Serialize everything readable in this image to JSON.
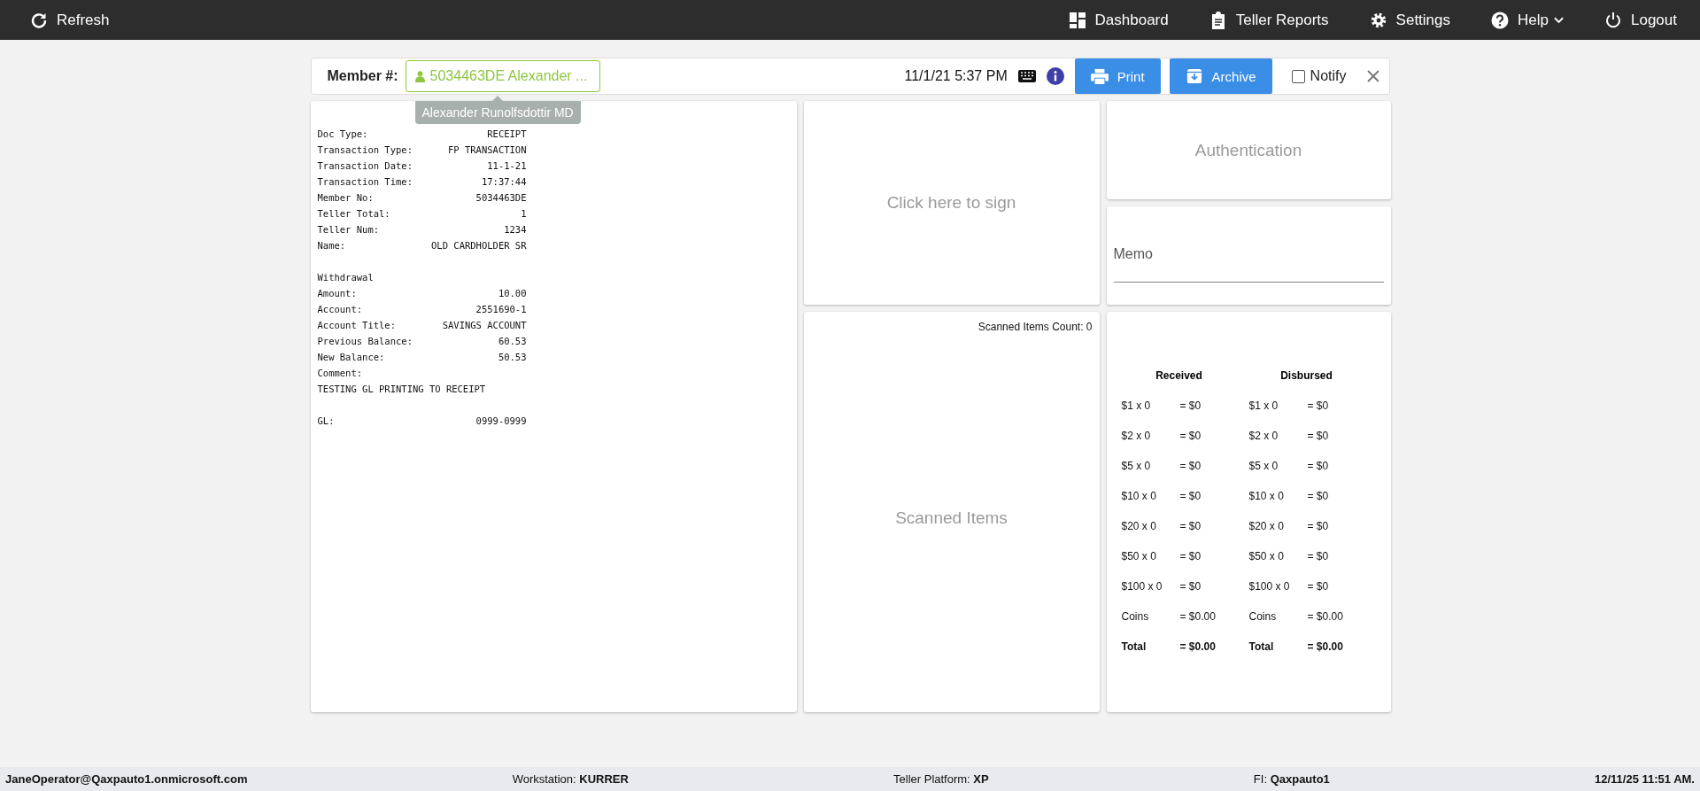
{
  "top_bar": {
    "left": [
      {
        "label": "Refresh"
      }
    ],
    "right": [
      {
        "label": "Dashboard",
        "dropdown": false
      },
      {
        "label": "Teller Reports",
        "dropdown": false
      },
      {
        "label": "Settings",
        "dropdown": false
      },
      {
        "label": "Help",
        "dropdown": true
      },
      {
        "label": "Logout",
        "dropdown": false
      }
    ]
  },
  "header": {
    "member_label": "Member #:",
    "member_value": "5034463DE Alexander ...",
    "tooltip": "Alexander Runolfsdottir MD",
    "datetime": "11/1/21 5:37 PM",
    "print_button": "Print",
    "archive_button": "Archive",
    "notify": {
      "label": "Notify",
      "checked": false
    }
  },
  "receipt": [
    {
      "kind": "pair",
      "label": "Doc Type:",
      "value": "RECEIPT"
    },
    {
      "kind": "pair",
      "label": "Transaction Type:",
      "value": "FP TRANSACTION"
    },
    {
      "kind": "pair",
      "label": "Transaction Date:",
      "value": "11-1-21"
    },
    {
      "kind": "pair",
      "label": "Transaction Time:",
      "value": "17:37:44"
    },
    {
      "kind": "pair",
      "label": "Member No:",
      "value": "5034463DE"
    },
    {
      "kind": "pair",
      "label": "Teller Total:",
      "value": "1"
    },
    {
      "kind": "pair",
      "label": "Teller Num:",
      "value": "1234"
    },
    {
      "kind": "pair",
      "label": "Name:",
      "value": "OLD CARDHOLDER SR"
    },
    {
      "kind": "gap"
    },
    {
      "kind": "text",
      "text": "Withdrawal"
    },
    {
      "kind": "pair",
      "label": "Amount:",
      "value": "10.00"
    },
    {
      "kind": "pair",
      "label": "Account:",
      "value": "2551690-1"
    },
    {
      "kind": "pair",
      "label": "Account Title:",
      "value": "SAVINGS ACCOUNT"
    },
    {
      "kind": "pair",
      "label": "Previous Balance:",
      "value": "60.53"
    },
    {
      "kind": "pair",
      "label": "New Balance:",
      "value": "50.53"
    },
    {
      "kind": "text",
      "text": "Comment:"
    },
    {
      "kind": "text",
      "text": "TESTING GL PRINTING TO RECEIPT"
    },
    {
      "kind": "gap"
    },
    {
      "kind": "pair",
      "label": "GL:",
      "value": "0999-0999"
    }
  ],
  "signature": {
    "prompt": "Click here to sign"
  },
  "scanned": {
    "count": "Scanned Items Count: 0",
    "placeholder": "Scanned Items"
  },
  "authentication": {
    "label": "Authentication"
  },
  "memo": {
    "placeholder": "Memo"
  },
  "cash": [
    {
      "heading": "Received",
      "rows": [
        {
          "kind": "line",
          "denom": "$1 x 0",
          "amount": "= $0"
        },
        {
          "kind": "line",
          "denom": "$2 x 0",
          "amount": "= $0"
        },
        {
          "kind": "line",
          "denom": "$5 x 0",
          "amount": "= $0"
        },
        {
          "kind": "line",
          "denom": "$10 x 0",
          "amount": "= $0"
        },
        {
          "kind": "line",
          "denom": "$20 x 0",
          "amount": "= $0"
        },
        {
          "kind": "line",
          "denom": "$50 x 0",
          "amount": "= $0"
        },
        {
          "kind": "line",
          "denom": "$100 x 0",
          "amount": "= $0"
        },
        {
          "kind": "line",
          "denom": "Coins",
          "amount": "= $0.00"
        },
        {
          "kind": "total",
          "denom": "Total",
          "amount": "= $0.00"
        }
      ]
    },
    {
      "heading": "Disbursed",
      "rows": [
        {
          "kind": "line",
          "denom": "$1 x 0",
          "amount": "= $0"
        },
        {
          "kind": "line",
          "denom": "$2 x 0",
          "amount": "= $0"
        },
        {
          "kind": "line",
          "denom": "$5 x 0",
          "amount": "= $0"
        },
        {
          "kind": "line",
          "denom": "$10 x 0",
          "amount": "= $0"
        },
        {
          "kind": "line",
          "denom": "$20 x 0",
          "amount": "= $0"
        },
        {
          "kind": "line",
          "denom": "$50 x 0",
          "amount": "= $0"
        },
        {
          "kind": "line",
          "denom": "$100 x 0",
          "amount": "= $0"
        },
        {
          "kind": "line",
          "denom": "Coins",
          "amount": "= $0.00"
        },
        {
          "kind": "total",
          "denom": "Total",
          "amount": "= $0.00"
        }
      ]
    }
  ],
  "status_bar": {
    "user": "JaneOperator@Qaxpauto1.onmicrosoft.com",
    "fields": [
      {
        "label": "Workstation:",
        "value": "KURRER"
      },
      {
        "label": "Teller Platform:",
        "value": "XP"
      },
      {
        "label": "FI:",
        "value": "Qaxpauto1"
      }
    ],
    "datetime": "12/11/25 11:51 AM."
  }
}
